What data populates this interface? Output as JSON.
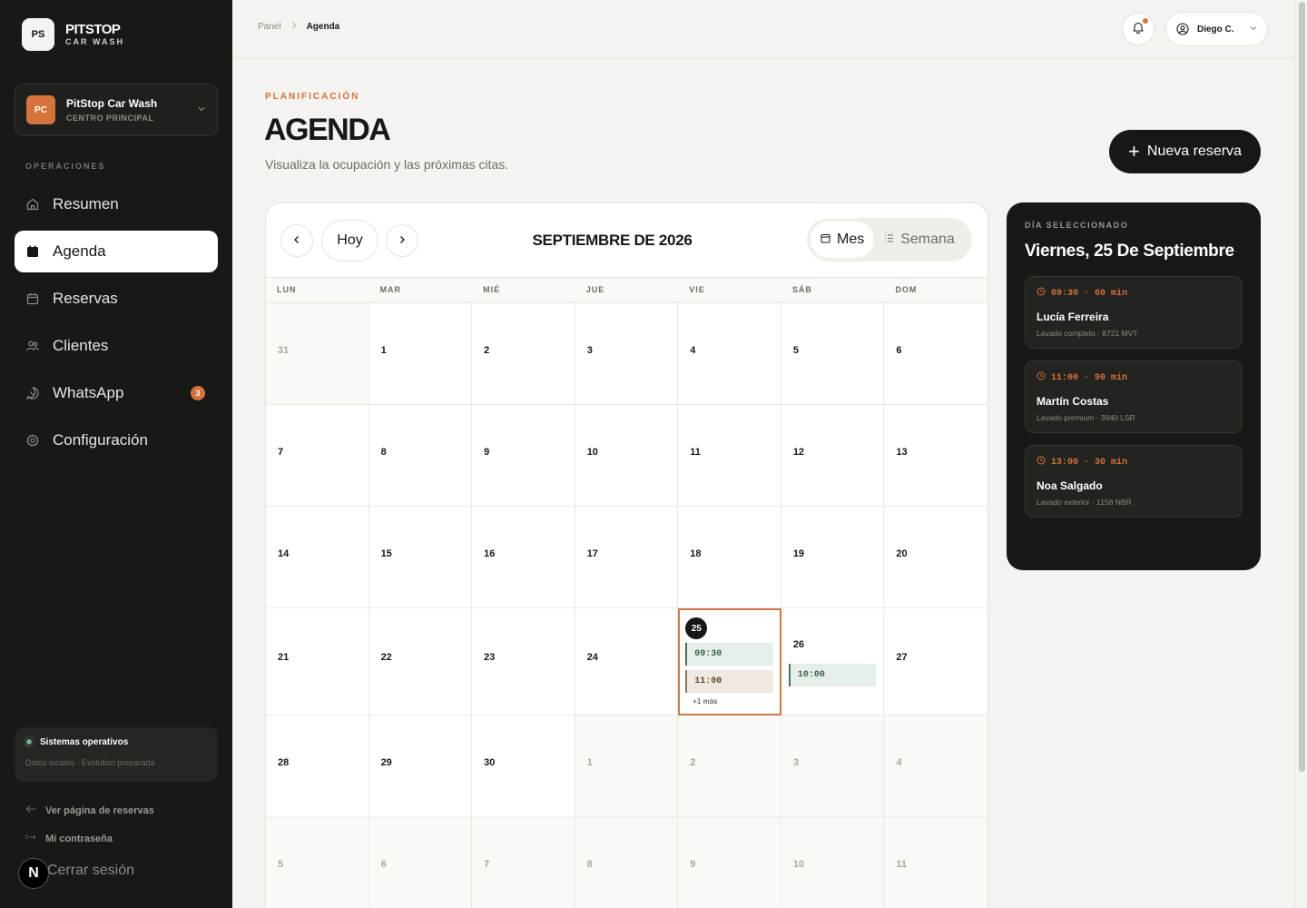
{
  "brand": {
    "badge": "PS",
    "title": "PITSTOP",
    "subtitle": "CAR WASH"
  },
  "center": {
    "badge": "PC",
    "name": "PitStop Car Wash",
    "subtitle": "CENTRO PRINCIPAL"
  },
  "sidebar": {
    "section_label": "OPERACIONES",
    "items": [
      {
        "label": "Resumen",
        "icon": "home-icon",
        "active": false
      },
      {
        "label": "Agenda",
        "icon": "calendar-icon",
        "active": true
      },
      {
        "label": "Reservas",
        "icon": "calendar-outline-icon",
        "active": false
      },
      {
        "label": "Clientes",
        "icon": "users-icon",
        "active": false
      },
      {
        "label": "WhatsApp",
        "icon": "whatsapp-icon",
        "active": false,
        "badge": "3"
      },
      {
        "label": "Configuración",
        "icon": "gear-icon",
        "active": false
      }
    ],
    "status_title": "Sistemas operativos",
    "status_sub": "Datos locales · Evolution preparada",
    "link_booking": "Ver página de reservas",
    "link_password": "Mi contraseña",
    "logout": "Cerrar sesión",
    "n_badge": "N"
  },
  "topbar": {
    "breadcrumb_root": "Panel",
    "breadcrumb_current": "Agenda",
    "user_name": "Diego C."
  },
  "header": {
    "eyebrow": "PLANIFICACIÓN",
    "title": "AGENDA",
    "subtitle": "Visualiza la ocupación y las próximas citas.",
    "new_button": "Nueva reserva"
  },
  "calendar": {
    "today_label": "Hoy",
    "month_title": "SEPTIEMBRE DE 2026",
    "view_month": "Mes",
    "view_week": "Semana",
    "weekdays": [
      "LUN",
      "MAR",
      "MIÉ",
      "JUE",
      "VIE",
      "SÁB",
      "DOM"
    ],
    "weeks": [
      [
        {
          "d": "31",
          "m": true
        },
        {
          "d": "1"
        },
        {
          "d": "2"
        },
        {
          "d": "3"
        },
        {
          "d": "4"
        },
        {
          "d": "5"
        },
        {
          "d": "6"
        }
      ],
      [
        {
          "d": "7"
        },
        {
          "d": "8"
        },
        {
          "d": "9"
        },
        {
          "d": "10"
        },
        {
          "d": "11"
        },
        {
          "d": "12"
        },
        {
          "d": "13"
        }
      ],
      [
        {
          "d": "14"
        },
        {
          "d": "15"
        },
        {
          "d": "16"
        },
        {
          "d": "17"
        },
        {
          "d": "18"
        },
        {
          "d": "19"
        },
        {
          "d": "20"
        }
      ],
      [
        {
          "d": "21"
        },
        {
          "d": "22"
        },
        {
          "d": "23"
        },
        {
          "d": "24"
        },
        {
          "d": "25",
          "selected": true,
          "events": [
            {
              "time": "09:30",
              "tone": "green"
            },
            {
              "time": "11:00",
              "tone": "beige"
            }
          ],
          "more": "+1 más"
        },
        {
          "d": "26",
          "events": [
            {
              "time": "10:00",
              "tone": "green"
            }
          ]
        },
        {
          "d": "27"
        }
      ],
      [
        {
          "d": "28"
        },
        {
          "d": "29"
        },
        {
          "d": "30"
        },
        {
          "d": "1",
          "m": true
        },
        {
          "d": "2",
          "m": true
        },
        {
          "d": "3",
          "m": true
        },
        {
          "d": "4",
          "m": true
        }
      ],
      [
        {
          "d": "5",
          "m": true
        },
        {
          "d": "6",
          "m": true
        },
        {
          "d": "7",
          "m": true
        },
        {
          "d": "8",
          "m": true
        },
        {
          "d": "9",
          "m": true
        },
        {
          "d": "10",
          "m": true
        },
        {
          "d": "11",
          "m": true
        }
      ]
    ]
  },
  "selected_day": {
    "eyebrow": "DÍA SELECCIONADO",
    "title": "Viernes, 25 De Septiembre",
    "appointments": [
      {
        "time": "09:30 · 60 min",
        "name": "Lucía Ferreira",
        "desc": "Lavado completo · 8721 MVT"
      },
      {
        "time": "11:00 · 90 min",
        "name": "Martín Costas",
        "desc": "Lavado premium · 3940 LSR"
      },
      {
        "time": "13:00 · 30 min",
        "name": "Noa Salgado",
        "desc": "Lavado exterior · 1158 NBR"
      }
    ]
  },
  "colors": {
    "accent": "#d4733b",
    "sidebar_bg": "#181816",
    "page_bg": "#f4f3ef"
  }
}
